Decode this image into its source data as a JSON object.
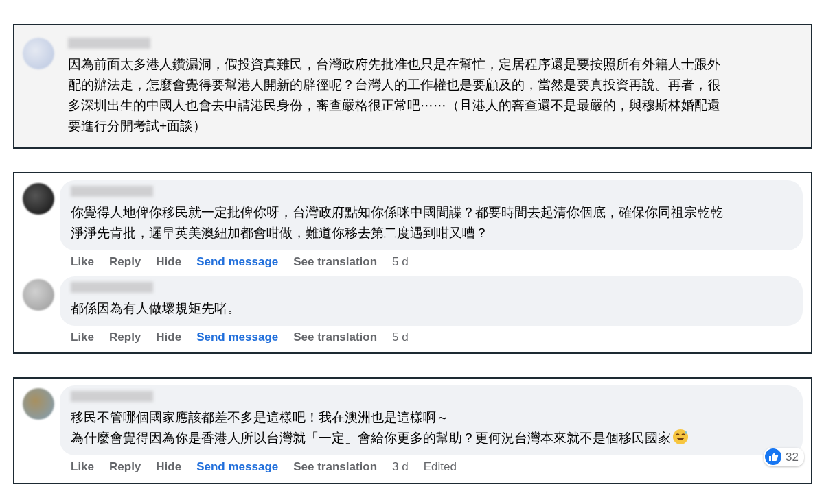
{
  "panels": [
    {
      "kind": "plain",
      "comments": [
        {
          "kind": "text",
          "lines": [
            "因為前面太多港人鑽漏洞，假投資真難民，台灣政府先批准也只是在幫忙，定居程序還是要按照所有外籍人士跟外",
            "配的辦法走，怎麼會覺得要幫港人開新的辟徑呢？台灣人的工作權也是要顧及的，當然是要真投資再說。再者，很",
            "多深圳出生的中國人也會去申請港民身份，審查嚴格很正常吧⋯⋯（且港人的審查還不是最嚴的，與穆斯林婚配還",
            "要進行分開考試+面談）"
          ]
        }
      ]
    },
    {
      "kind": "bubble",
      "comments": [
        {
          "kind": "text",
          "lines": [
            "你覺得人地俾你移民就一定批俾你呀，台灣政府點知你係咪中國間諜？都要時間去起清你個底，確保你同祖宗乾乾",
            "淨淨先肯批，遲早英美澳紐加都會咁做，難道你移去第二度遇到咁又嘈？"
          ],
          "actions": [
            {
              "kind": "action",
              "text": "Like"
            },
            {
              "kind": "action",
              "text": "Reply"
            },
            {
              "kind": "action",
              "text": "Hide"
            },
            {
              "kind": "link",
              "text": "Send message"
            },
            {
              "kind": "action",
              "text": "See translation"
            },
            {
              "kind": "meta",
              "text": "5 d"
            }
          ]
        },
        {
          "kind": "text",
          "lines": [
            "都係因為有人做壞規矩先啫。"
          ],
          "actions": [
            {
              "kind": "action",
              "text": "Like"
            },
            {
              "kind": "action",
              "text": "Reply"
            },
            {
              "kind": "action",
              "text": "Hide"
            },
            {
              "kind": "link",
              "text": "Send message"
            },
            {
              "kind": "action",
              "text": "See translation"
            },
            {
              "kind": "meta",
              "text": "5 d"
            }
          ]
        }
      ]
    },
    {
      "kind": "bubble",
      "comments": [
        {
          "kind": "text-emoji",
          "lines": [
            "移民不管哪個國家應該都差不多是這樣吧！我在澳洲也是這樣啊～",
            "為什麼會覺得因為你是香港人所以台灣就「一定」會給你更多的幫助？更何況台灣本來就不是個移民國家"
          ],
          "reactions": "32",
          "actions": [
            {
              "kind": "action",
              "text": "Like"
            },
            {
              "kind": "action",
              "text": "Reply"
            },
            {
              "kind": "action",
              "text": "Hide"
            },
            {
              "kind": "link",
              "text": "Send message"
            },
            {
              "kind": "action",
              "text": "See translation"
            },
            {
              "kind": "meta",
              "text": "3 d"
            },
            {
              "kind": "meta",
              "text": "Edited"
            }
          ]
        }
      ]
    }
  ]
}
